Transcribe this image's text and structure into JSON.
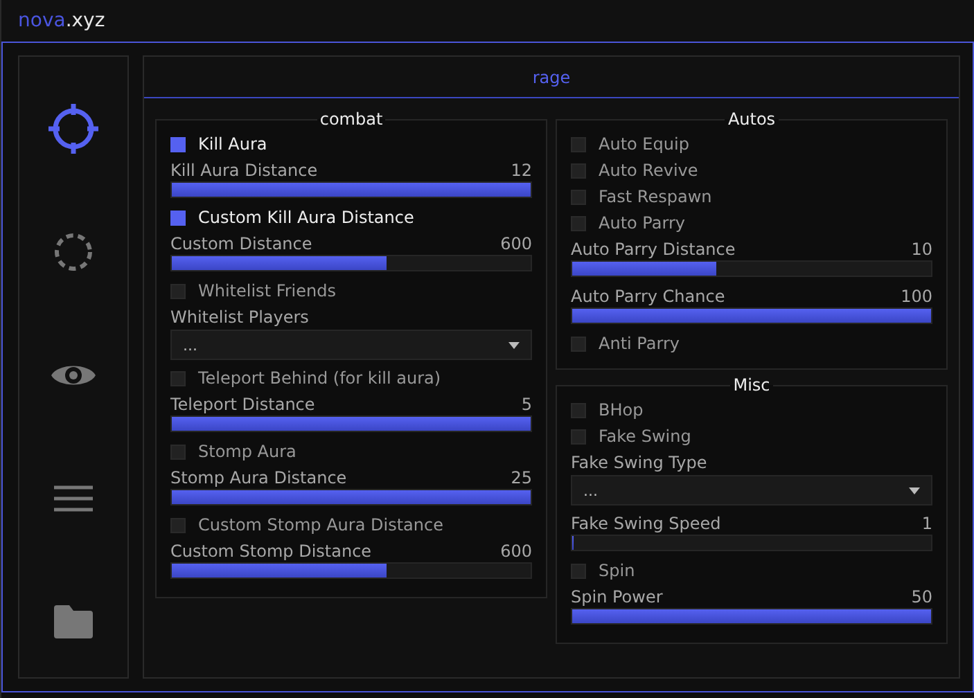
{
  "window": {
    "title_accent": "nova",
    "title_rest": ".xyz"
  },
  "sidebar": {
    "items": [
      {
        "selected": true
      },
      {
        "selected": false
      },
      {
        "selected": false
      },
      {
        "selected": false
      },
      {
        "selected": false
      }
    ]
  },
  "tab": {
    "label": "rage"
  },
  "columns": [
    [
      {
        "title": "combat",
        "items": [
          {
            "kind": "toggle",
            "label": "Kill Aura",
            "checked": true
          },
          {
            "kind": "slider",
            "label": "Kill Aura Distance",
            "reading": "12",
            "level": 1
          },
          {
            "kind": "toggle",
            "label": "Custom Kill Aura Distance",
            "checked": true
          },
          {
            "kind": "slider",
            "label": "Custom Distance",
            "reading": "600",
            "level": 0.6
          },
          {
            "kind": "toggle",
            "label": "Whitelist Friends",
            "checked": false
          },
          {
            "kind": "dropdown",
            "label": "Whitelist Players",
            "value": "..."
          },
          {
            "kind": "toggle",
            "label": "Teleport Behind (for kill aura)",
            "checked": false
          },
          {
            "kind": "slider",
            "label": "Teleport Distance",
            "reading": "5",
            "level": 1
          },
          {
            "kind": "toggle",
            "label": "Stomp Aura",
            "checked": false
          },
          {
            "kind": "slider",
            "label": "Stomp Aura Distance",
            "reading": "25",
            "level": 1
          },
          {
            "kind": "toggle",
            "label": "Custom Stomp Aura Distance",
            "checked": false
          },
          {
            "kind": "slider",
            "label": "Custom Stomp Distance",
            "reading": "600",
            "level": 0.6
          }
        ]
      }
    ],
    [
      {
        "title": "Autos",
        "items": [
          {
            "kind": "toggle",
            "label": "Auto Equip",
            "checked": false
          },
          {
            "kind": "toggle",
            "label": "Auto Revive",
            "checked": false
          },
          {
            "kind": "toggle",
            "label": "Fast Respawn",
            "checked": false
          },
          {
            "kind": "toggle",
            "label": "Auto Parry",
            "checked": false
          },
          {
            "kind": "slider",
            "label": "Auto Parry Distance",
            "reading": "10",
            "level": 0.4
          },
          {
            "kind": "slider",
            "label": "Auto Parry Chance",
            "reading": "100",
            "level": 1
          },
          {
            "kind": "toggle",
            "label": "Anti Parry",
            "checked": false
          }
        ]
      },
      {
        "title": "Misc",
        "items": [
          {
            "kind": "toggle",
            "label": "BHop",
            "checked": false
          },
          {
            "kind": "toggle",
            "label": "Fake Swing",
            "checked": false
          },
          {
            "kind": "dropdown",
            "label": "Fake Swing Type",
            "value": "..."
          },
          {
            "kind": "slider",
            "label": "Fake Swing Speed",
            "reading": "1",
            "level": 0
          },
          {
            "kind": "toggle",
            "label": "Spin",
            "checked": false
          },
          {
            "kind": "slider",
            "label": "Spin Power",
            "reading": "50",
            "level": 1
          }
        ]
      }
    ]
  ]
}
